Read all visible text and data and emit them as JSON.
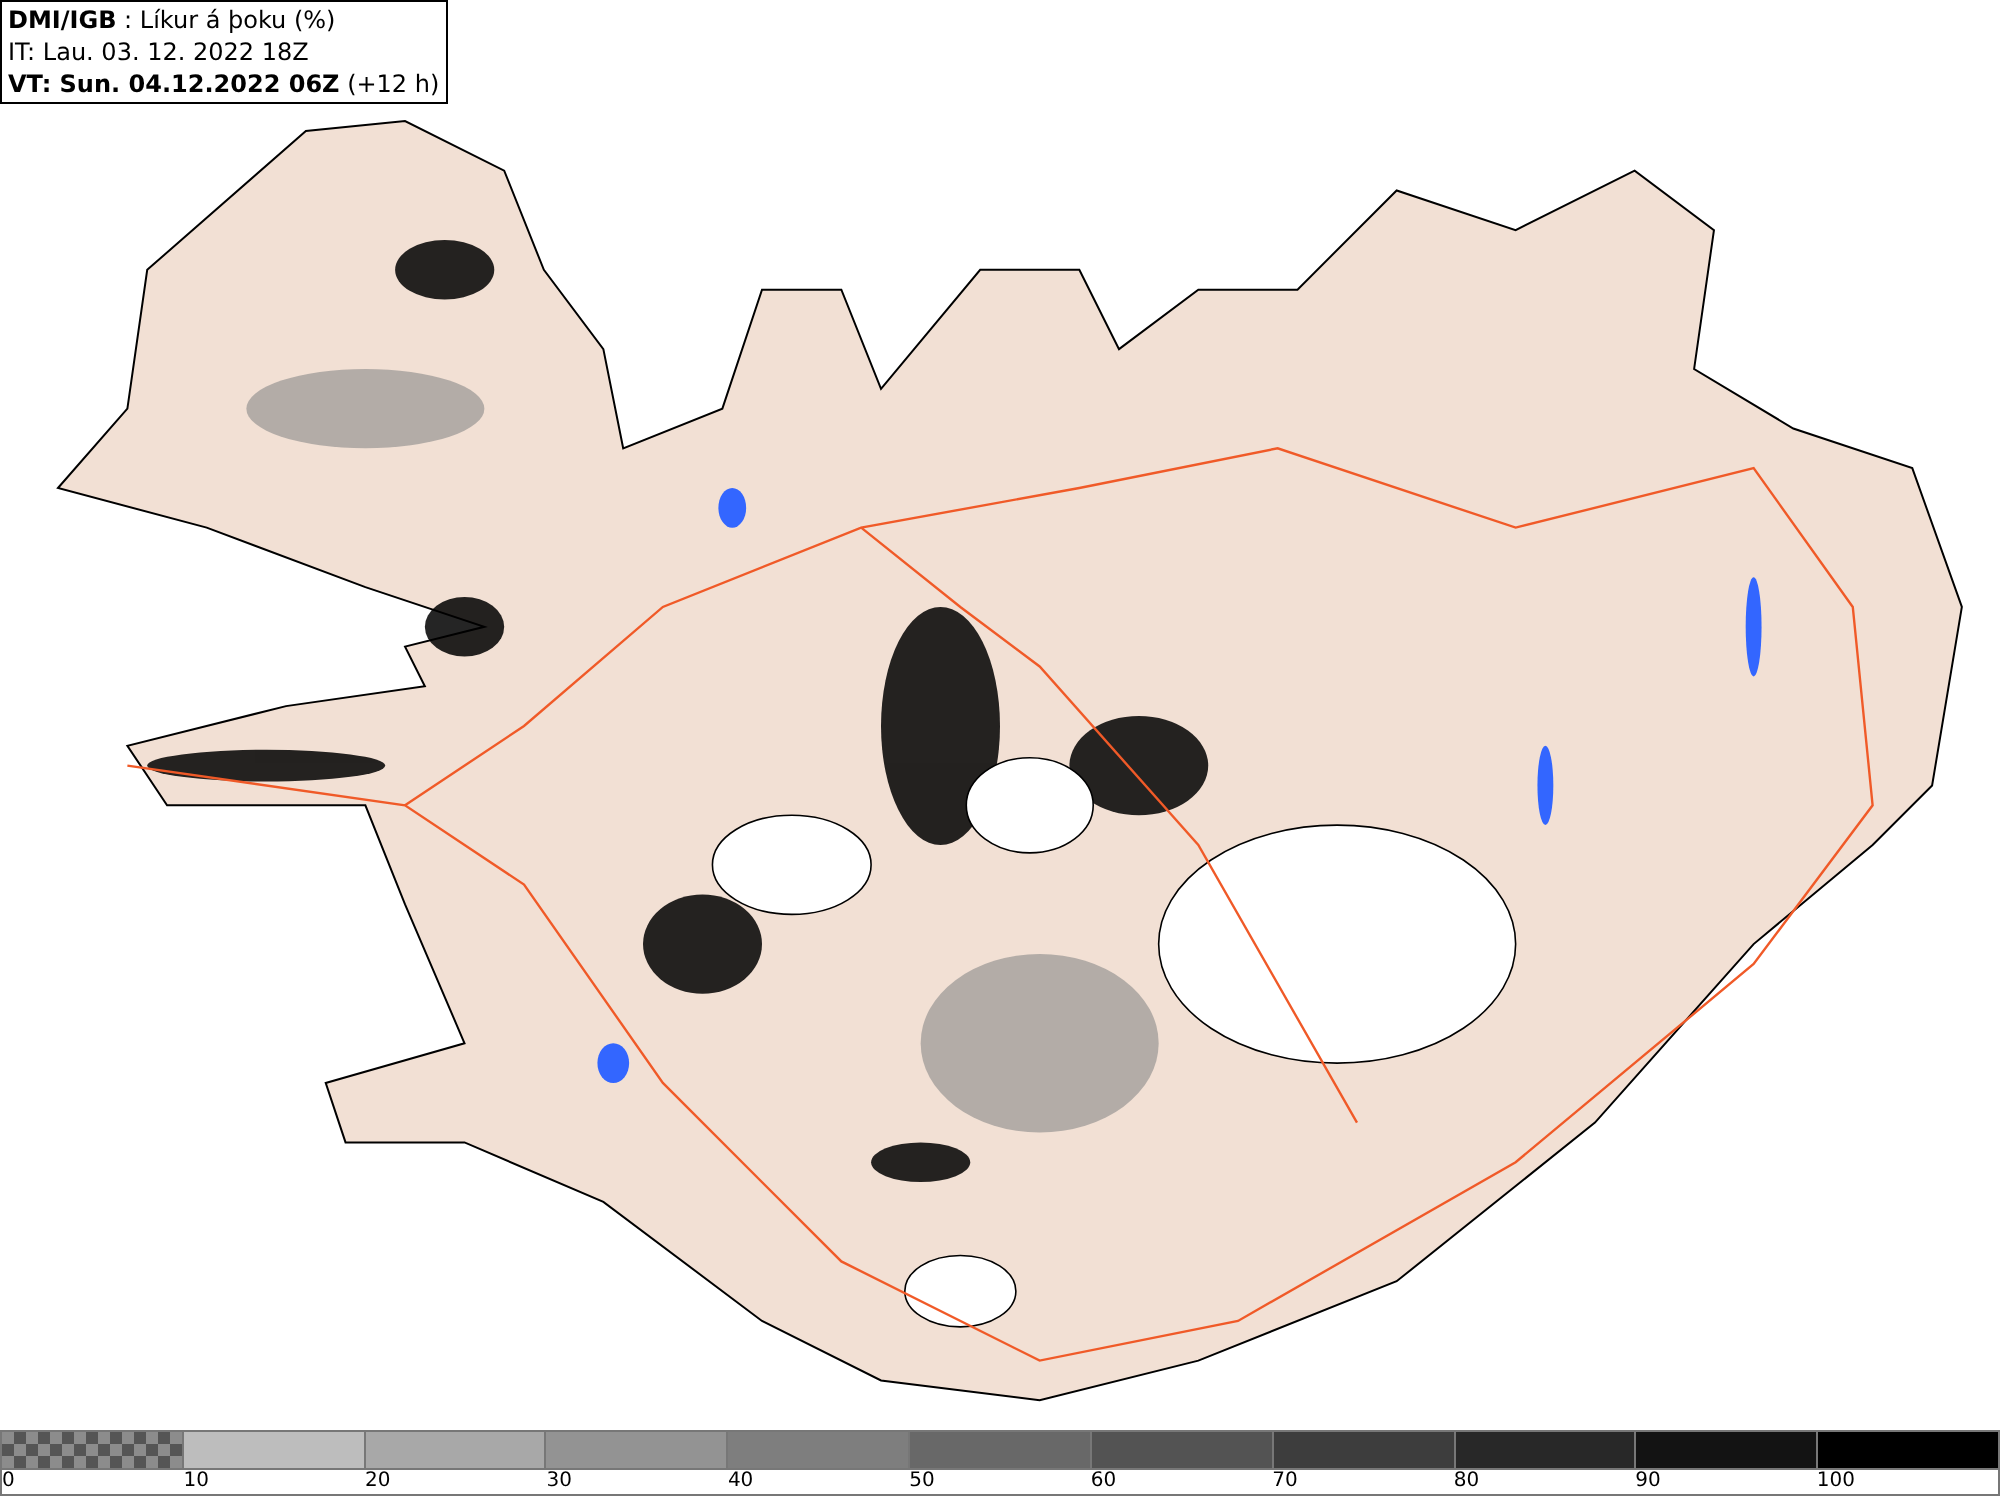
{
  "header": {
    "title": "**DMI/IGB** : Líkur á þoku (%)",
    "issue_time": "IT: Lau. 03. 12. 2022 18Z",
    "valid_time": "**VT: Sun. 04.12.2022 06Z** (+12 h)"
  },
  "legend": {
    "swatches": [
      {
        "kind": "pattern",
        "color": "#8c8c8c"
      },
      {
        "kind": "solid",
        "color": "#bdbdbd"
      },
      {
        "kind": "solid",
        "color": "#a8a8a8"
      },
      {
        "kind": "solid",
        "color": "#939393"
      },
      {
        "kind": "solid",
        "color": "#7e7e7e"
      },
      {
        "kind": "solid",
        "color": "#686868"
      },
      {
        "kind": "solid",
        "color": "#535353"
      },
      {
        "kind": "solid",
        "color": "#3d3d3d"
      },
      {
        "kind": "solid",
        "color": "#282828"
      },
      {
        "kind": "solid",
        "color": "#131313"
      },
      {
        "kind": "solid",
        "color": "#000000"
      }
    ],
    "labels": [
      "0",
      "10",
      "20",
      "30",
      "40",
      "50",
      "60",
      "70",
      "80",
      "90",
      "100"
    ]
  }
}
